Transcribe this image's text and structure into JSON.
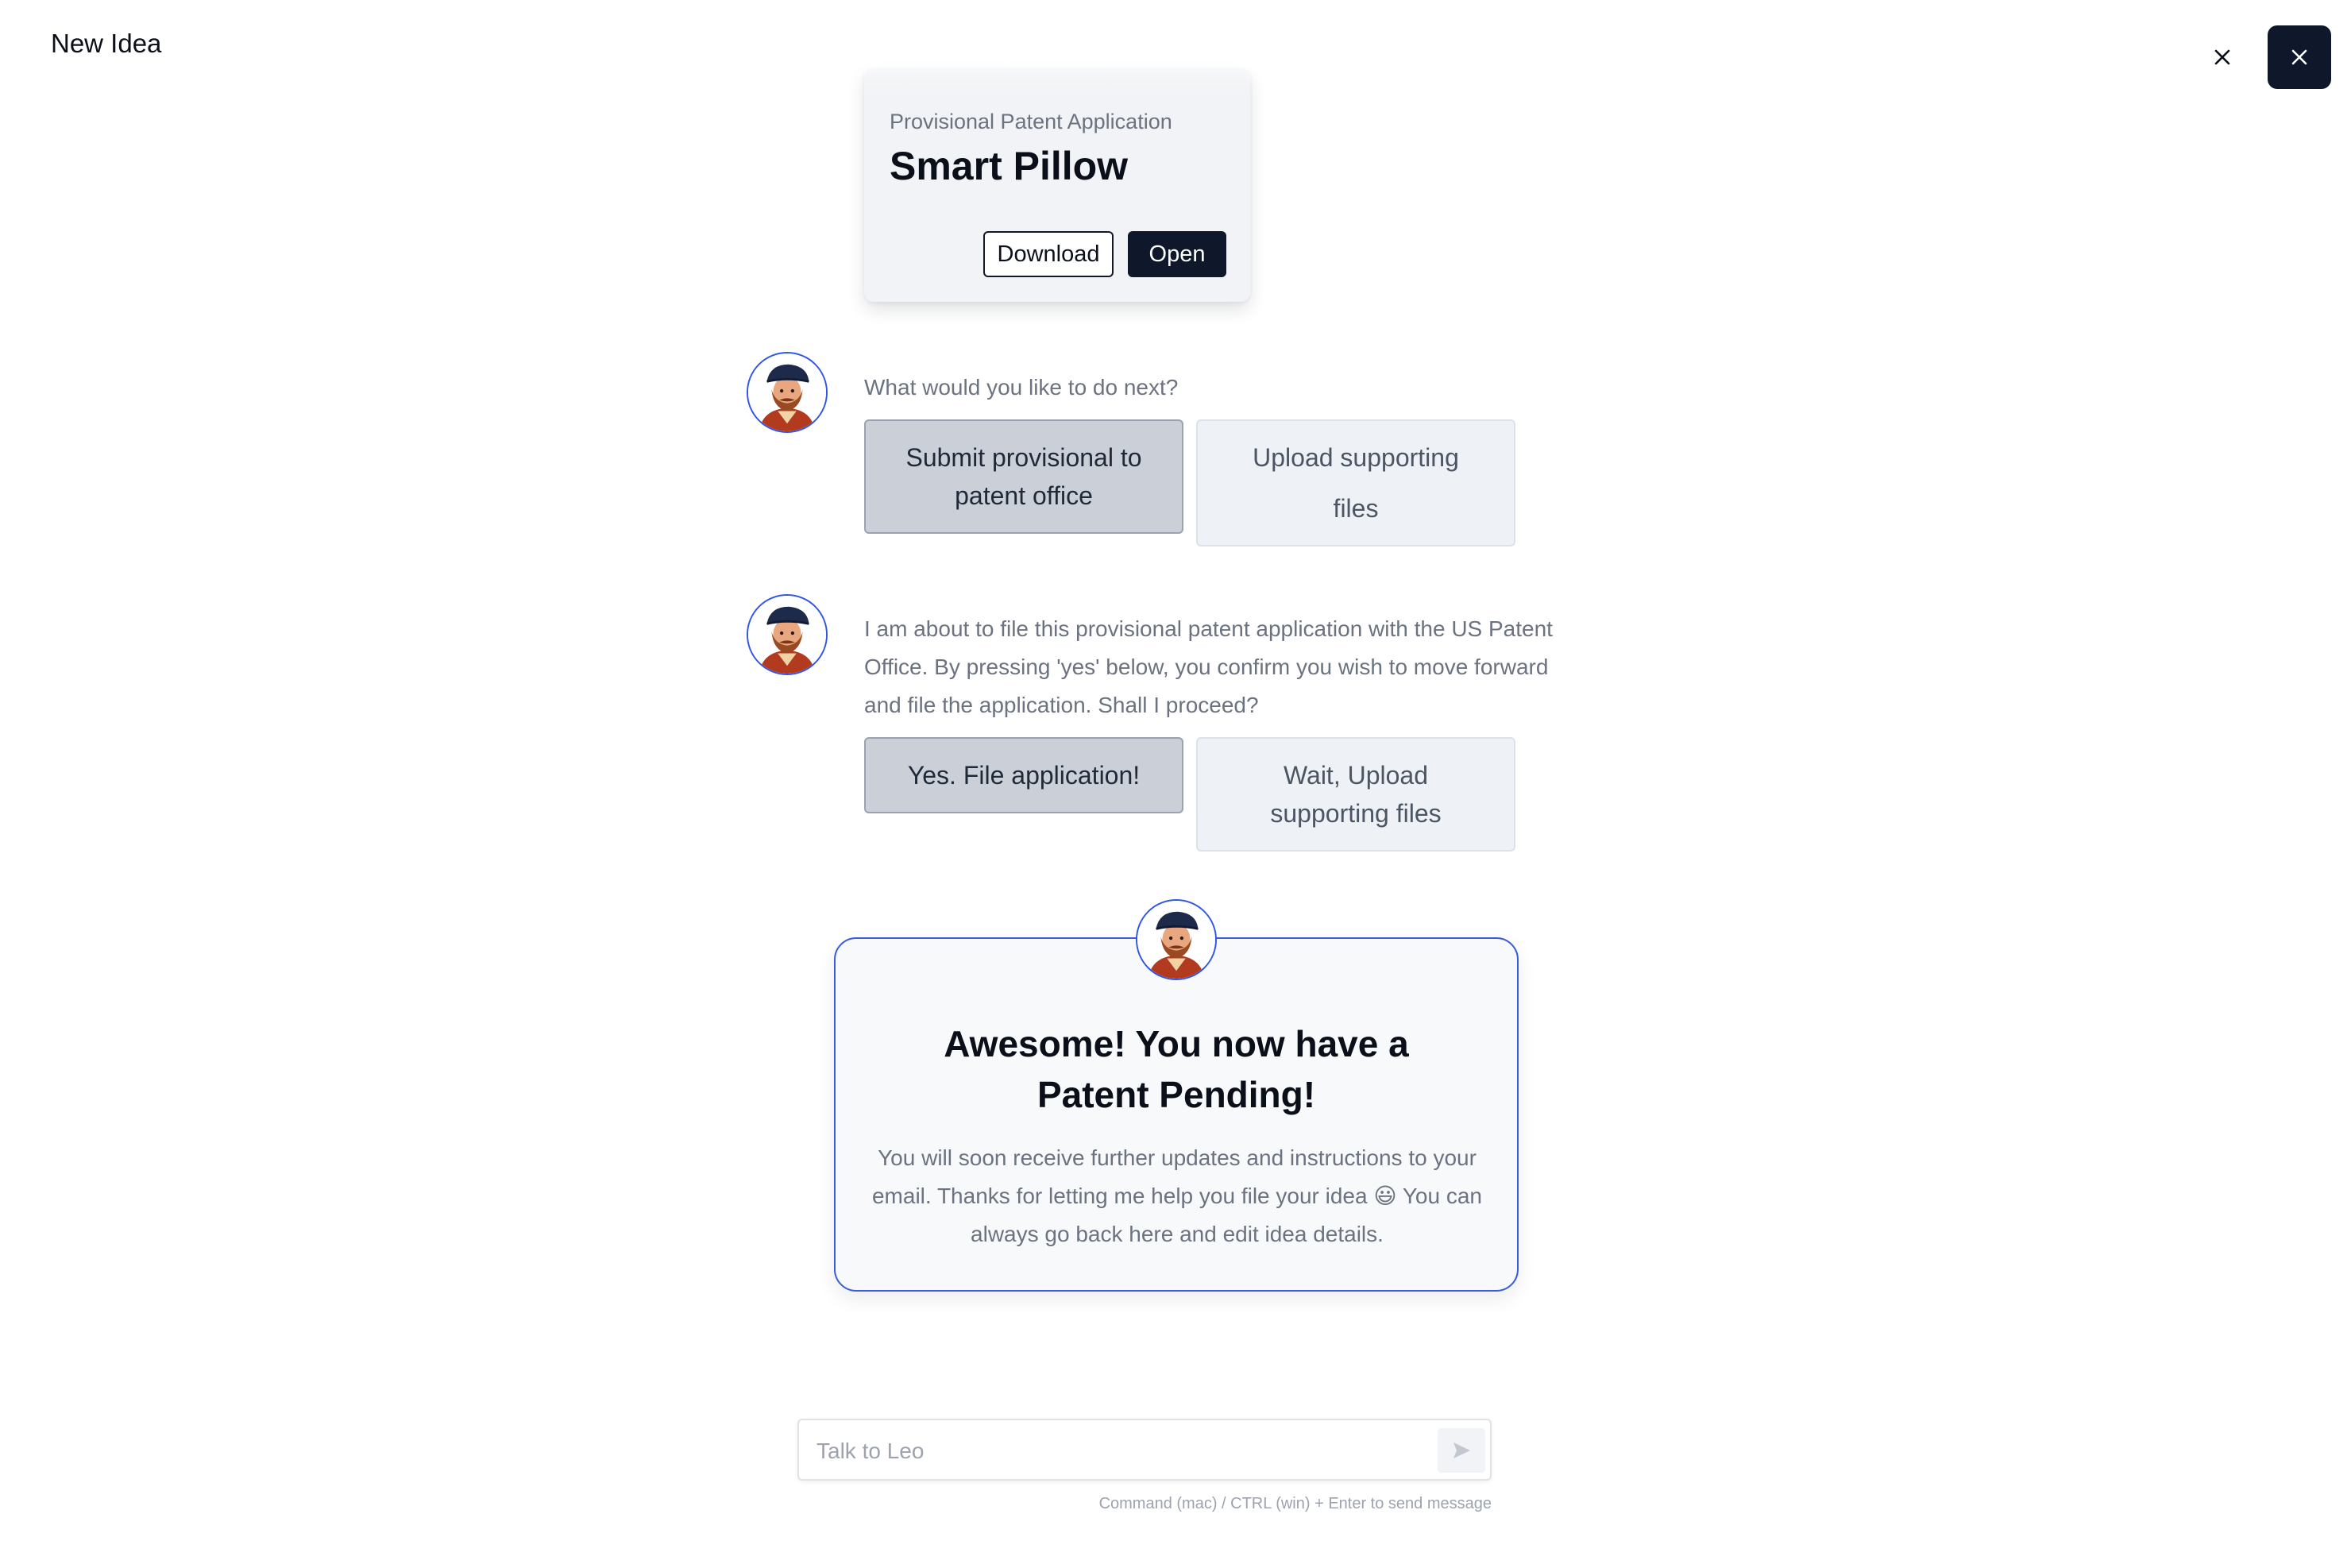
{
  "header": {
    "title": "New Idea"
  },
  "icons": {
    "close": "close-icon",
    "send": "send-icon",
    "avatar": "leo-avatar"
  },
  "document_card": {
    "subtitle": "Provisional Patent Application",
    "title": "Smart Pillow",
    "download_label": "Download",
    "open_label": "Open"
  },
  "messages": [
    {
      "text": "What would you like to do next?",
      "options": [
        "Submit provisional to patent office",
        "Upload supporting files"
      ],
      "selected": 0
    },
    {
      "text": "I am about to file this provisional patent application with the US Patent Office. By pressing 'yes' below, you confirm you wish to move forward and file the application. Shall I proceed?",
      "options": [
        "Yes. File application!",
        "Wait, Upload supporting files"
      ],
      "selected": 0
    }
  ],
  "success": {
    "title": "Awesome! You now have a Patent Pending!",
    "body": "You will soon receive further updates and instructions to your email. Thanks for letting me help you file your idea 😃 You can always go back here and edit idea details."
  },
  "chat": {
    "placeholder": "Talk to Leo",
    "hint": "Command (mac) / CTRL (win) + Enter to send message"
  },
  "colors": {
    "accent": "#3b5bdb",
    "dark": "#0f172a",
    "selected_option": "#cbd0d8",
    "option": "#eef1f5"
  }
}
